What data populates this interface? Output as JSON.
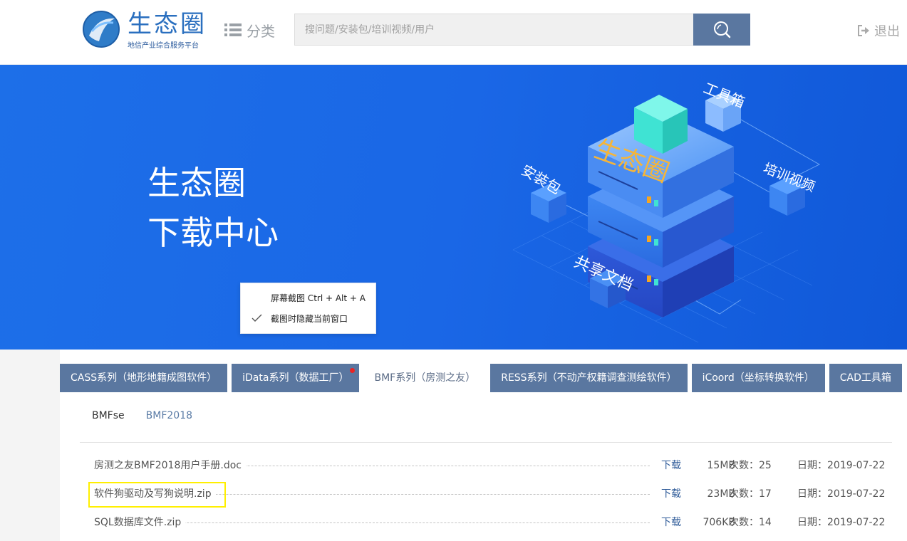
{
  "header": {
    "logo_title": "生态圈",
    "logo_subtitle": "地信产业综合服务平台",
    "category_label": "分类",
    "search_placeholder": "搜问题/安装包/培训视频/用户",
    "logout_label": "退出"
  },
  "banner": {
    "line1": "生态圈",
    "line2": "下载中心",
    "art_labels": {
      "center": "生态圈",
      "toolbox": "工具箱",
      "install": "安装包",
      "training": "培训视频",
      "docs": "共享文档"
    }
  },
  "context_menu": {
    "items": [
      {
        "label": "屏幕截图 Ctrl + Alt + A",
        "checked": false
      },
      {
        "label": "截图时隐藏当前窗口",
        "checked": true
      }
    ]
  },
  "tabs": [
    {
      "label": "CASS系列（地形地籍成图软件）",
      "active": false,
      "has_dot": false
    },
    {
      "label": "iData系列（数据工厂）",
      "active": false,
      "has_dot": true
    },
    {
      "label": "BMF系列（房测之友）",
      "active": true,
      "has_dot": false
    },
    {
      "label": "RESS系列（不动产权籍调查测绘软件）",
      "active": false,
      "has_dot": false
    },
    {
      "label": "iCoord（坐标转换软件）",
      "active": false,
      "has_dot": false
    },
    {
      "label": "CAD工具箱",
      "active": false,
      "has_dot": false
    }
  ],
  "subtabs": [
    {
      "label": "BMFse",
      "active": true
    },
    {
      "label": "BMF2018",
      "active": false
    }
  ],
  "files": [
    {
      "name": "房测之友BMF2018用户手册.doc",
      "download": "下载",
      "size": "15MB",
      "count": "次数：25",
      "date": "日期：2019-07-22"
    },
    {
      "name": "软件狗驱动及写狗说明.zip",
      "download": "下载",
      "size": "23MB",
      "count": "次数：17",
      "date": "日期：2019-07-22"
    },
    {
      "name": "SQL数据库文件.zip",
      "download": "下载",
      "size": "706KB",
      "count": "次数：14",
      "date": "日期：2019-07-22"
    }
  ],
  "colors": {
    "accent": "#5a77a0",
    "banner_blue": "#1a67e6",
    "link_blue": "#2d5a98",
    "highlight": "#ffef00",
    "notify_dot": "#e82525"
  }
}
